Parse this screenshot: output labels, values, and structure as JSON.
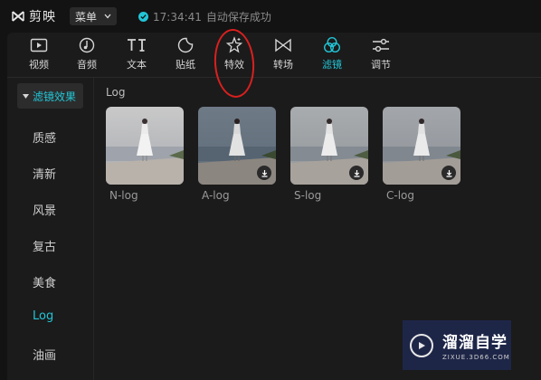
{
  "app": {
    "name": "剪映",
    "menu_label": "菜单",
    "save_time": "17:34:41",
    "save_text": "自动保存成功"
  },
  "toolbar": {
    "items": [
      {
        "label": "视频",
        "icon": "video-icon"
      },
      {
        "label": "音频",
        "icon": "audio-icon"
      },
      {
        "label": "文本",
        "icon": "text-icon"
      },
      {
        "label": "贴纸",
        "icon": "sticker-icon"
      },
      {
        "label": "特效",
        "icon": "effects-icon"
      },
      {
        "label": "转场",
        "icon": "transition-icon"
      },
      {
        "label": "滤镜",
        "icon": "filter-icon",
        "active": true
      },
      {
        "label": "调节",
        "icon": "adjust-icon"
      }
    ]
  },
  "sidebar": {
    "header": "滤镜效果",
    "items": [
      "质感",
      "清新",
      "风景",
      "复古",
      "美食",
      "Log",
      "油画"
    ],
    "active": "Log"
  },
  "content": {
    "section_title": "Log",
    "filters": [
      {
        "name": "N-log",
        "downloadable": false
      },
      {
        "name": "A-log",
        "downloadable": true
      },
      {
        "name": "S-log",
        "downloadable": true
      },
      {
        "name": "C-log",
        "downloadable": true
      }
    ]
  },
  "watermark": {
    "title": "溜溜自学",
    "url": "ZIXUE.3D66.COM"
  },
  "colors": {
    "accent": "#22c5d6",
    "annotation": "#d9201f",
    "background": "#131313",
    "panel": "#1b1b1b"
  }
}
